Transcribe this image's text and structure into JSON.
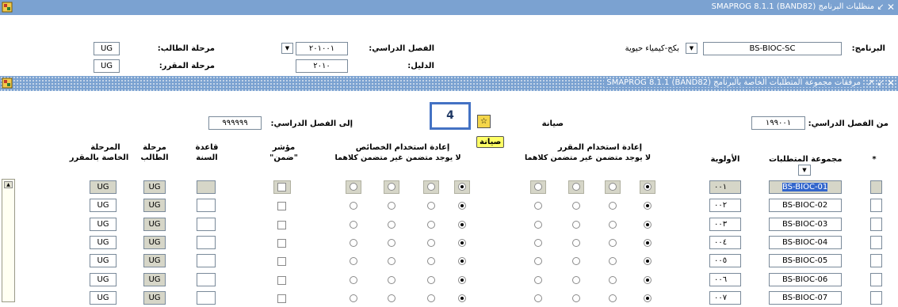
{
  "window1": {
    "title": "منظلبات البرنامج  SMAPROG  8.1.1  (BAND82)",
    "program_label": "البرنامج:",
    "program_value": "BS-BIOC-SC",
    "program_desc": "بكح-كيمياء حيوية",
    "term_label": "الفصل الدراسي:",
    "term_value": "٢٠١٠٠١",
    "catalog_label": "الدليل:",
    "catalog_value": "٢٠١٠",
    "student_level_label": "مرحلة الطالب:",
    "student_level_value": "UG",
    "course_level_label": "مرحلة المقرر:",
    "course_level_value": "UG"
  },
  "window2": {
    "title": "مرفقات مجموعة المتطلبات الخاصة بالبرنامج  SMAPROG  8.1.1  (BAND82)",
    "from_term_label": "من الفصل الدراسي:",
    "from_term_value": "١٩٩٠٠١",
    "to_term_label": "إلى الفصل الدراسي:",
    "to_term_value": "٩٩٩٩٩٩",
    "maintenance_label": "صيانة",
    "maintenance_button": "صيانة",
    "callout_number": "4",
    "headers": {
      "star": "*",
      "requirement_group": "مجموعة المتطلبات",
      "priority": "الأولوية",
      "course_reuse": "إعادة استخدام المقرر",
      "course_reuse_options": "لا يوجد  متضمن  غير متضمن  كلاهما",
      "attribute_reuse": "إعادة استخدام الخصائص",
      "attribute_reuse_options": "لا يوجد  متضمن  غير متضمن  كلاهما",
      "indicator_line1": "مؤشر",
      "indicator_line2": "\"ضمن\"",
      "year_rule_line1": "قاعدة",
      "year_rule_line2": "السنة",
      "student_level_line1": "مرحلة",
      "student_level_line2": "الطالب",
      "course_level_line1": "المرحلة",
      "course_level_line2": "الخاصة بالمقرر"
    },
    "rows": [
      {
        "group": "BS-BIOC-01",
        "priority": "٠٠١",
        "student_level": "UG",
        "course_level": "UG"
      },
      {
        "group": "BS-BIOC-02",
        "priority": "٠٠٢",
        "student_level": "UG",
        "course_level": "UG"
      },
      {
        "group": "BS-BIOC-03",
        "priority": "٠٠٣",
        "student_level": "UG",
        "course_level": "UG"
      },
      {
        "group": "BS-BIOC-04",
        "priority": "٠٠٤",
        "student_level": "UG",
        "course_level": "UG"
      },
      {
        "group": "BS-BIOC-05",
        "priority": "٠٠٥",
        "student_level": "UG",
        "course_level": "UG"
      },
      {
        "group": "BS-BIOC-06",
        "priority": "٠٠٦",
        "student_level": "UG",
        "course_level": "UG"
      },
      {
        "group": "BS-BIOC-07",
        "priority": "٠٠٧",
        "student_level": "UG",
        "course_level": "UG"
      }
    ]
  },
  "colors": {
    "titlebar": "#7ba2d1",
    "selected_row": "#d6d6c8",
    "highlight": "#3366cc",
    "callout_border": "#4472c4"
  }
}
